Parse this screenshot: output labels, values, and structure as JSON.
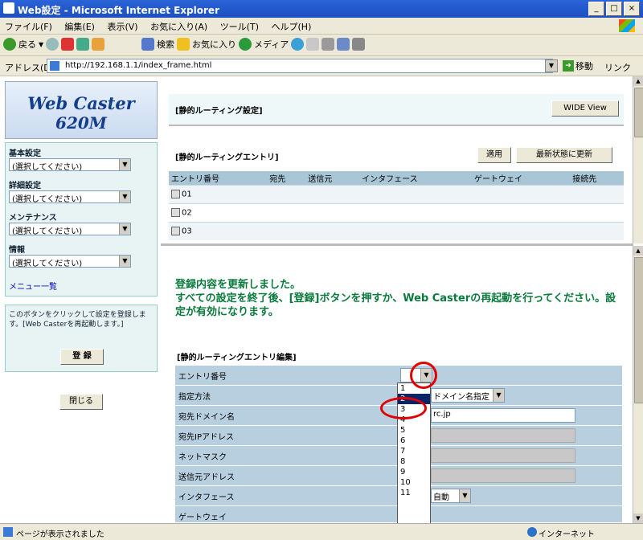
{
  "window": {
    "title": "Web設定 - Microsoft Internet Explorer",
    "min": "_",
    "max": "□",
    "close": "×"
  },
  "menu": [
    "ファイル(F)",
    "編集(E)",
    "表示(V)",
    "お気に入り(A)",
    "ツール(T)",
    "ヘルプ(H)"
  ],
  "toolbar": {
    "back": "戻る",
    "search": "検索",
    "favorites": "お気に入り",
    "media": "メディア"
  },
  "address": {
    "label": "アドレス(D)",
    "url": "http://192.168.1.1/index_frame.html",
    "go": "移動",
    "links": "リンク"
  },
  "logo": {
    "line1": "Web Caster",
    "line2": "620M"
  },
  "sidebar": {
    "groups": [
      {
        "label": "基本設定",
        "value": "(選択してください)"
      },
      {
        "label": "詳細設定",
        "value": "(選択してください)"
      },
      {
        "label": "メンテナンス",
        "value": "(選択してください)"
      },
      {
        "label": "情報",
        "value": "(選択してください)"
      }
    ],
    "menu_list": "メニュー一覧",
    "register_note": "このボタンをクリックして設定を登録します。[Web Casterを再起動します。]",
    "register_button": "登 録",
    "close_button": "閉じる"
  },
  "top": {
    "header": "[静的ルーティング設定]",
    "wide_view": "WIDE View",
    "table_title": "[静的ルーティングエントリ]",
    "apply": "適用",
    "refresh": "最新状態に更新",
    "columns": [
      "エントリ番号",
      "宛先",
      "送信元",
      "インタフェース",
      "ゲートウェイ",
      "接続先"
    ],
    "rows": [
      "01",
      "02",
      "03"
    ]
  },
  "bottom": {
    "message_line1": "登録内容を更新しました。",
    "message_line2": "すべての設定を終了後、[登録]ボタンを押すか、Web Casterの再起動を行ってください。設定が有効になります。",
    "edit_title": "[静的ルーティングエントリ編集]",
    "fields": [
      {
        "label": "エントリ番号",
        "value": ""
      },
      {
        "label": "指定方法",
        "value": "ドメイン名指定"
      },
      {
        "label": "宛先ドメイン名",
        "value": "rc.jp"
      },
      {
        "label": "宛先IPアドレス",
        "value": ""
      },
      {
        "label": "ネットマスク",
        "value": ""
      },
      {
        "label": "送信元アドレス",
        "value": ""
      },
      {
        "label": "インタフェース",
        "value": "自動"
      },
      {
        "label": "ゲートウェイ",
        "value": ""
      }
    ],
    "dropdown_options": [
      "1",
      "2",
      "3",
      "4",
      "5",
      "6",
      "7",
      "8",
      "9",
      "10",
      "11"
    ],
    "dropdown_selected": "2"
  },
  "status": {
    "text": "ページが表示されました",
    "zone": "インターネット"
  },
  "colors": {
    "title_blue": "#1d4fc2",
    "message_green": "#0a7a3c",
    "highlight_red": "#e00000"
  }
}
